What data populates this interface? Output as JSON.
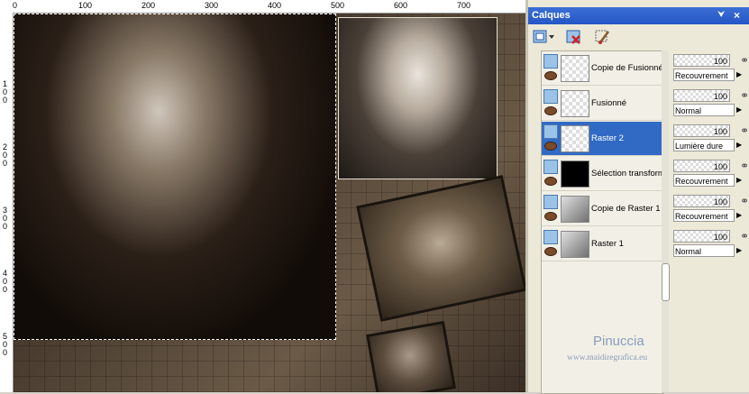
{
  "rulers": {
    "top": [
      "0",
      "100",
      "200",
      "300",
      "400",
      "500",
      "600",
      "700"
    ],
    "left": [
      "1\n0\n0",
      "2\n0\n0",
      "3\n0\n0",
      "4\n0\n0",
      "5\n0\n0"
    ]
  },
  "panel": {
    "title": "Calques",
    "pin": "⮟",
    "close": "×"
  },
  "layers": [
    {
      "name": "Copie de Fusionné",
      "opacity": "100",
      "blend": "Recouvrement",
      "selected": false
    },
    {
      "name": "Fusionné",
      "opacity": "100",
      "blend": "Normal",
      "selected": false
    },
    {
      "name": "Raster 2",
      "opacity": "100",
      "blend": "Lumière dure",
      "selected": true
    },
    {
      "name": "Sélection transformée",
      "opacity": "100",
      "blend": "Recouvrement",
      "selected": false
    },
    {
      "name": "Copie de Raster 1",
      "opacity": "100",
      "blend": "Recouvrement",
      "selected": false
    },
    {
      "name": "Raster 1",
      "opacity": "100",
      "blend": "Normal",
      "selected": false
    }
  ],
  "watermark": {
    "name": "Pinuccia",
    "url": "www.maidiregrafica.eu"
  },
  "icons": {
    "new-layer": "new-layer-icon",
    "delete-layer": "delete-layer-icon",
    "brush": "brush-icon",
    "eye": "eye-icon",
    "link": "link-icon"
  }
}
